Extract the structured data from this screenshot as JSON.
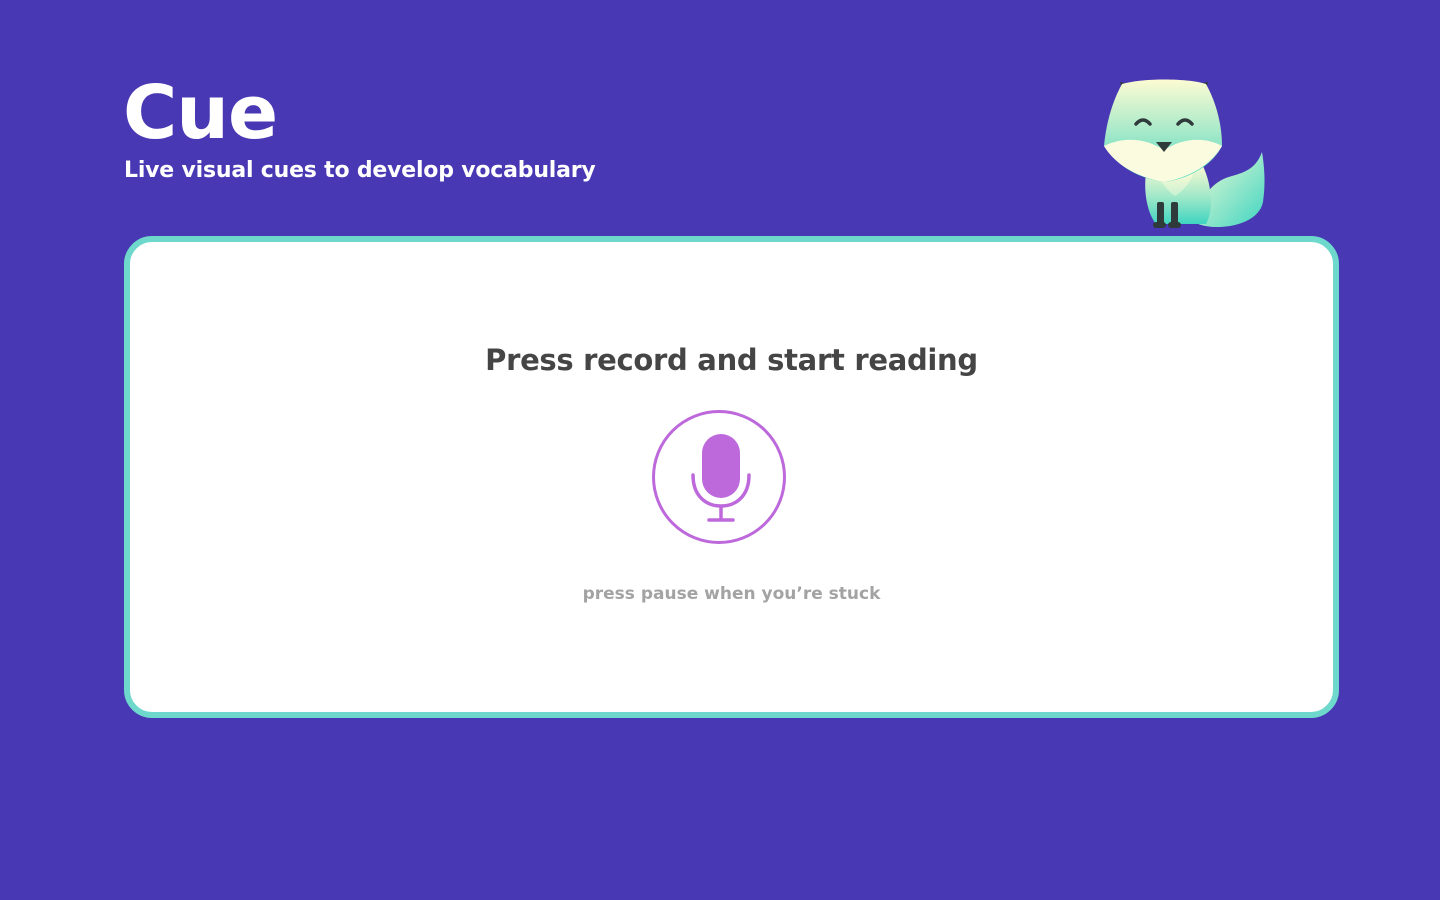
{
  "app": {
    "title": "Cue",
    "tagline": "Live visual cues to develop vocabulary"
  },
  "mascot": {
    "icon": "fox-mascot-icon"
  },
  "card": {
    "heading": "Press record and start reading",
    "record_button": {
      "icon": "microphone-icon",
      "aria_label": "Record"
    },
    "hint": "press pause when you’re stuck"
  },
  "colors": {
    "background": "#4838b3",
    "card_border": "#6dd8cb",
    "accent_purple": "#bd69db",
    "heading_text": "#454545",
    "hint_text": "#a3a3a3"
  }
}
